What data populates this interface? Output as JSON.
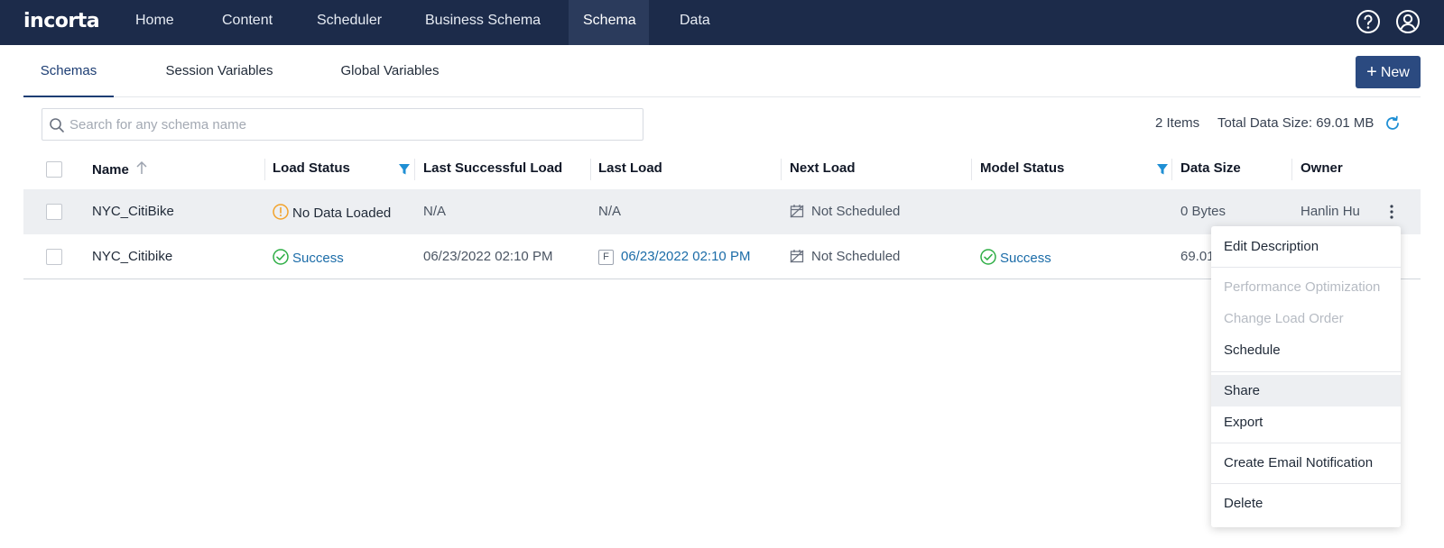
{
  "app": {
    "logo": "incorta"
  },
  "nav": {
    "items": [
      "Home",
      "Content",
      "Scheduler",
      "Business Schema",
      "Schema",
      "Data"
    ],
    "active": "Schema"
  },
  "tabs": {
    "items": [
      "Schemas",
      "Session Variables",
      "Global Variables"
    ],
    "active": "Schemas"
  },
  "new_button": {
    "label": "New"
  },
  "search": {
    "placeholder": "Search for any schema name",
    "value": ""
  },
  "summary": {
    "items": "2 Items",
    "total_size": "Total Data Size: 69.01 MB"
  },
  "table": {
    "headers": [
      "Name",
      "Load Status",
      "Last Successful Load",
      "Last Load",
      "Next Load",
      "Model Status",
      "Data Size",
      "Owner"
    ],
    "rows": [
      {
        "name": "NYC_CitiBike",
        "load_status": "No Data Loaded",
        "last_successful_load": "N/A",
        "last_load": "N/A",
        "next_load": "Not Scheduled",
        "model_status": "",
        "data_size": "0 Bytes",
        "owner": "Hanlin Hu"
      },
      {
        "name": "NYC_Citibike",
        "load_status": "Success",
        "last_successful_load": "06/23/2022 02:10 PM",
        "last_load_type": "F",
        "last_load": "06/23/2022 02:10 PM",
        "next_load": "Not Scheduled",
        "model_status": "Success",
        "data_size": "69.01",
        "owner": ""
      }
    ]
  },
  "context_menu": {
    "items": [
      {
        "label": "Edit Description",
        "enabled": true
      },
      {
        "label": "Performance Optimization",
        "enabled": false
      },
      {
        "label": "Change Load Order",
        "enabled": false
      },
      {
        "label": "Schedule",
        "enabled": true
      },
      {
        "label": "Share",
        "enabled": true,
        "highlighted": true
      },
      {
        "label": "Export",
        "enabled": true
      },
      {
        "label": "Create Email Notification",
        "enabled": true
      },
      {
        "label": "Delete",
        "enabled": true
      }
    ]
  },
  "colors": {
    "navbar": "#1c2b4a",
    "accent": "#2b4a80",
    "link": "#1b6ca8",
    "success": "#2eae45",
    "warning": "#f2a22b",
    "filter": "#1f8fd4"
  },
  "icons": [
    "help-icon",
    "user-icon",
    "search-icon",
    "refresh-icon",
    "sort-up-icon",
    "filter-icon",
    "warning-icon",
    "check-circle-icon",
    "calendar-off-icon",
    "more-vertical-icon",
    "plus-icon"
  ]
}
